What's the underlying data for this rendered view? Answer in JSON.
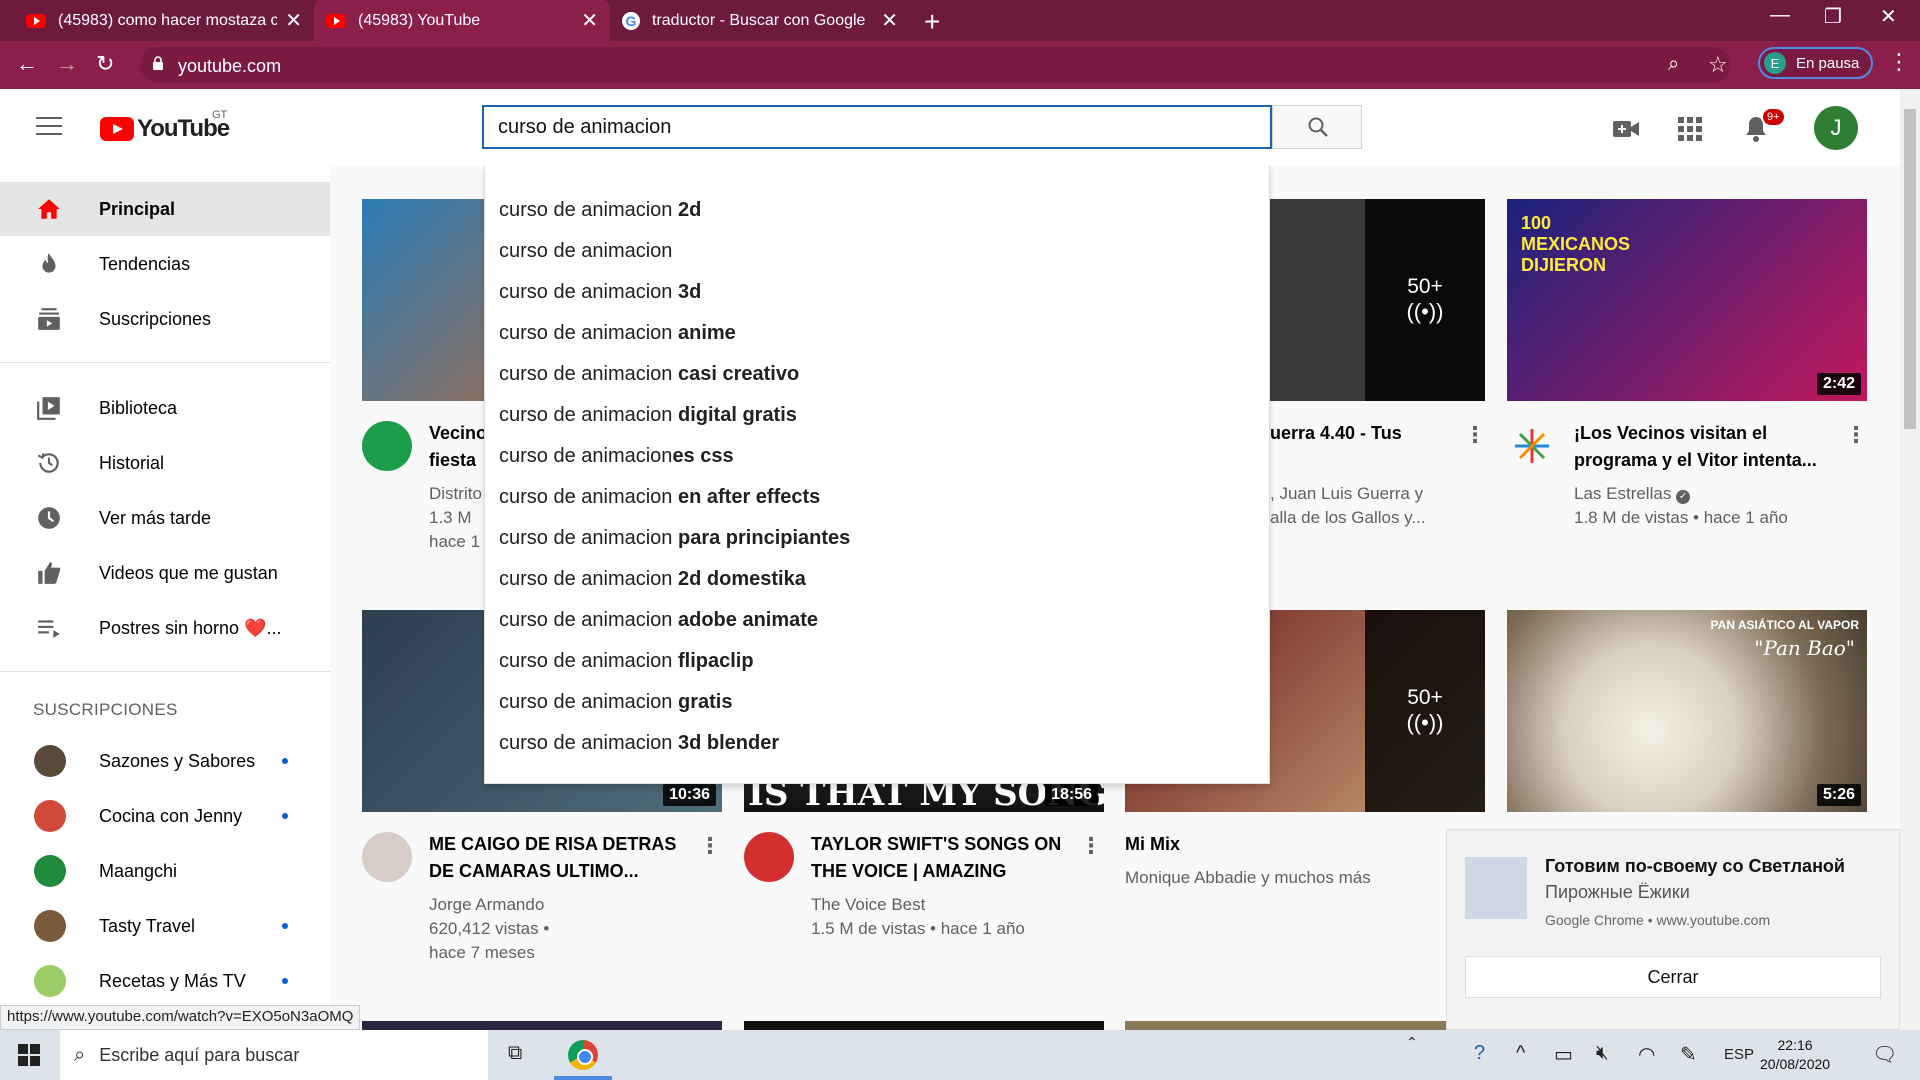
{
  "browser": {
    "tabs": [
      {
        "title": "(45983) como hacer mostaza casera",
        "icon": "youtube-favicon",
        "active": false
      },
      {
        "title": "(45983) YouTube",
        "icon": "youtube-favicon",
        "active": true
      },
      {
        "title": "traductor - Buscar con Google",
        "icon": "google-favicon",
        "active": false
      }
    ],
    "url": "youtube.com",
    "profile_initial": "E",
    "profile_label": "En pausa",
    "status_url": "https://www.youtube.com/watch?v=EXO5oN3aOMQ"
  },
  "header": {
    "logo_text": "YouTube",
    "country_code": "GT",
    "search_value": "curso de animacion",
    "notifications_badge": "9+",
    "avatar_initial": "J"
  },
  "suggestions": [
    {
      "base": "curso de animacion",
      "bold": " 2d"
    },
    {
      "base": "curso de animacion",
      "bold": ""
    },
    {
      "base": "curso de animacion",
      "bold": " 3d"
    },
    {
      "base": "curso de animacion",
      "bold": " anime"
    },
    {
      "base": "curso de animacion",
      "bold": " casi creativo"
    },
    {
      "base": "curso de animacion",
      "bold": " digital gratis"
    },
    {
      "base": "curso de animacion",
      "bold": "es css"
    },
    {
      "base": "curso de animacion",
      "bold": " en after effects"
    },
    {
      "base": "curso de animacion",
      "bold": " para principiantes"
    },
    {
      "base": "curso de animacion",
      "bold": " 2d domestika"
    },
    {
      "base": "curso de animacion",
      "bold": " adobe animate"
    },
    {
      "base": "curso de animacion",
      "bold": " flipaclip"
    },
    {
      "base": "curso de animacion",
      "bold": " gratis"
    },
    {
      "base": "curso de animacion",
      "bold": " 3d blender"
    }
  ],
  "sidebar": {
    "main": [
      {
        "label": "Principal",
        "icon": "home-icon"
      },
      {
        "label": "Tendencias",
        "icon": "trending-icon"
      },
      {
        "label": "Suscripciones",
        "icon": "subscriptions-icon"
      }
    ],
    "library": [
      {
        "label": "Biblioteca",
        "icon": "library-icon"
      },
      {
        "label": "Historial",
        "icon": "history-icon"
      },
      {
        "label": "Ver más tarde",
        "icon": "watch-later-icon"
      },
      {
        "label": "Videos que me gustan",
        "icon": "thumbs-up-icon"
      },
      {
        "label": "Postres sin horno ❤️...",
        "icon": "playlist-icon"
      }
    ],
    "subscriptions_heading": "SUSCRIPCIONES",
    "subscriptions": [
      {
        "label": "Sazones y Sabores",
        "new": true
      },
      {
        "label": "Cocina con Jenny",
        "new": true
      },
      {
        "label": "Maangchi",
        "new": false
      },
      {
        "label": "Tasty Travel",
        "new": true
      },
      {
        "label": "Recetas y Más TV",
        "new": true
      }
    ]
  },
  "videos": [
    {
      "title_line1": "Vecino",
      "title_line2": "fiesta",
      "meta1": "Distrito",
      "meta2": "1.3 M",
      "meta3": "hace 1"
    },
    {
      "title_line1": "uerra 4.40 - Tus",
      "meta1": ", Juan Luis Guerra y",
      "meta2": "alla de los Gallos y...",
      "mix_count": "50+"
    },
    {
      "title_line1": "¡Los Vecinos visitan el",
      "title_line2": "programa y el Vitor intenta...",
      "channel": "Las Estrellas",
      "meta2": "1.8 M de vistas • hace 1 año",
      "duration": "2:42",
      "thumb_text": "100 MEXICANOS DIJIERON"
    },
    {
      "title_line1": "ME CAIGO DE RISA DETRAS",
      "title_line2": "DE CAMARAS ULTIMO...",
      "channel": "Jorge Armando",
      "meta2": "620,412 vistas •",
      "meta3": "hace 7 meses",
      "duration": "10:36"
    },
    {
      "title_line1": "TAYLOR SWIFT'S SONGS ON",
      "title_line2": "THE VOICE | AMAZING",
      "channel": "The Voice Best",
      "meta2": "1.5 M de vistas • hace 1 año",
      "duration": "18:56",
      "thumb_text": "IS THAT MY SONG"
    },
    {
      "title_line1": "Mi Mix",
      "channel": "Monique Abbadie y muchos más",
      "mix_count": "50+"
    },
    {
      "duration": "5:26",
      "thumb_text1": "PAN ASIÁTICO AL VAPOR",
      "thumb_text2": "\"Pan Bao\""
    }
  ],
  "notification": {
    "title": "Готовим по-своему со Светланой",
    "subtitle": "Пирожные Ёжики",
    "source": "Google Chrome • www.youtube.com",
    "close_label": "Cerrar"
  },
  "taskbar": {
    "search_placeholder": "Escribe aquí para buscar",
    "language": "ESP",
    "time": "22:16",
    "date": "20/08/2020"
  }
}
